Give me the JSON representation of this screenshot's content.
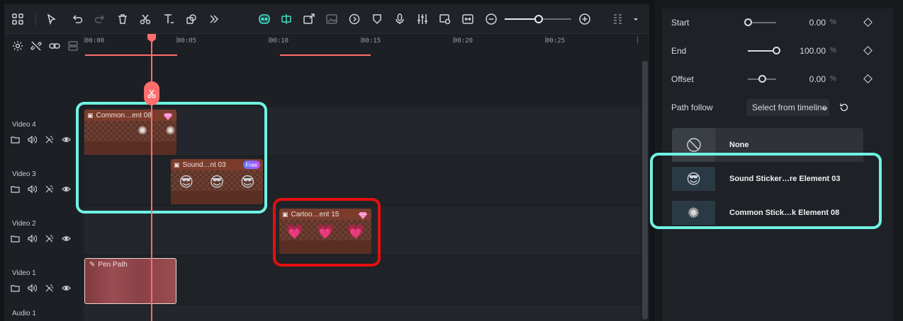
{
  "timeline": {
    "ruler_labels": [
      "00:00",
      "00:05",
      "00:10",
      "00:15",
      "00:20",
      "00:25"
    ],
    "tracks": [
      {
        "name": "Video 4"
      },
      {
        "name": "Video 3"
      },
      {
        "name": "Video 2"
      },
      {
        "name": "Video 1"
      },
      {
        "name": "Audio 1"
      }
    ],
    "clips": {
      "common": {
        "label": "Common…ent 08"
      },
      "sound": {
        "label": "Sound…nt 03",
        "badge": "Free"
      },
      "cartoon": {
        "label": "Cartoo…ent 15"
      },
      "pen": {
        "label": "Pen Path"
      }
    }
  },
  "properties": {
    "start": {
      "label": "Start",
      "value": "0.00",
      "unit": "%",
      "level": 0
    },
    "end": {
      "label": "End",
      "value": "100.00",
      "unit": "%",
      "level": 100
    },
    "offset": {
      "label": "Offset",
      "value": "0.00",
      "unit": "%",
      "level": 50
    },
    "path_follow": {
      "label": "Path follow",
      "selected": "Select from timeline"
    },
    "path_options": [
      {
        "name": "None",
        "icon": "none-icon"
      },
      {
        "name": "Sound Sticker…re Element 03",
        "icon": "sticker-thumb"
      },
      {
        "name": "Common Stick…k Element 08",
        "icon": "firework-thumb"
      }
    ]
  },
  "colors": {
    "accent_cyan": "#6ff3e3",
    "highlight_red": "#e60f0f",
    "playhead": "#ff6d6d",
    "toolbar_active": "#3fe0c5"
  }
}
